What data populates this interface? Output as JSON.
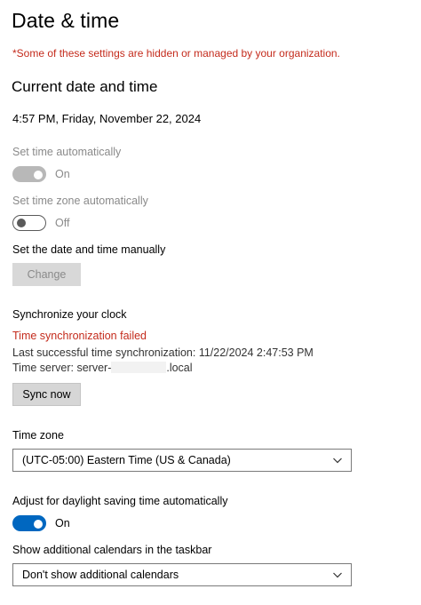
{
  "page": {
    "title": "Date & time",
    "org_notice": "*Some of these settings are hidden or managed by your organization."
  },
  "current": {
    "heading": "Current date and time",
    "value": "4:57 PM, Friday, November 22, 2024"
  },
  "auto_time": {
    "label": "Set time automatically",
    "state": "On",
    "enabled": false,
    "on": true
  },
  "auto_timezone": {
    "label": "Set time zone automatically",
    "state": "Off",
    "enabled": false,
    "on": false
  },
  "manual": {
    "label": "Set the date and time manually",
    "button": "Change"
  },
  "sync": {
    "label": "Synchronize your clock",
    "status": "Time synchronization failed",
    "last_sync": "Last successful time synchronization: 11/22/2024 2:47:53 PM",
    "server_prefix": "Time server: server-",
    "server_suffix": ".local",
    "button": "Sync now"
  },
  "timezone": {
    "label": "Time zone",
    "selected": "(UTC-05:00) Eastern Time (US & Canada)"
  },
  "dst": {
    "label": "Adjust for daylight saving time automatically",
    "state": "On",
    "on": true
  },
  "calendars": {
    "label": "Show additional calendars in the taskbar",
    "selected": "Don't show additional calendars"
  },
  "colors": {
    "accent": "#0067c0",
    "error": "#c42b1c",
    "disabled_text": "#8a8a8a"
  }
}
